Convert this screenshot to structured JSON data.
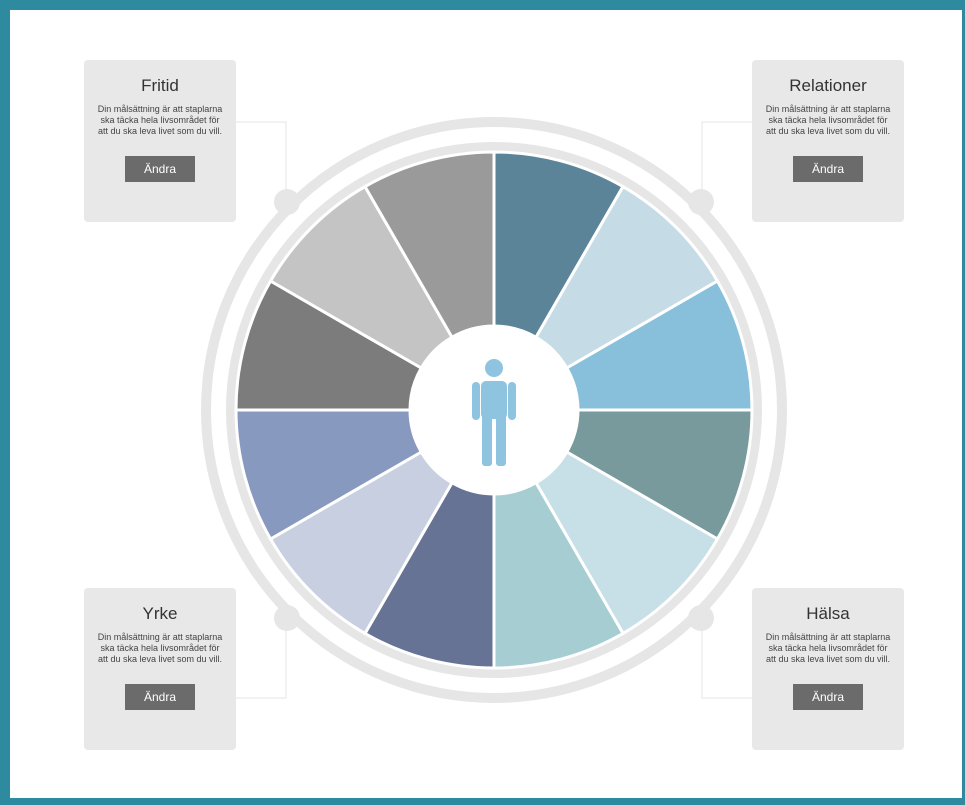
{
  "colors": {
    "frame": "#2e8a9f",
    "ring": "#e6e6e6",
    "card_bg": "#e8e8e8",
    "button_bg": "#6b6b6b",
    "person": "#8ec4df"
  },
  "wheel": {
    "center_icon": "person-icon",
    "segment_colors": [
      "#5b8499",
      "#c5dce6",
      "#88c0dc",
      "#799a9c",
      "#c7dfe6",
      "#a5cdd2",
      "#677394",
      "#c8cfe0",
      "#8899c0",
      "#7c7c7c",
      "#c4c4c4",
      "#9a9a9a"
    ]
  },
  "cards": {
    "fritid": {
      "title": "Fritid",
      "text": "Din målsättning är att staplarna ska täcka hela livsområdet för att du ska leva livet som du vill.",
      "button": "Ändra"
    },
    "relationer": {
      "title": "Relationer",
      "text": "Din målsättning är att staplarna ska täcka hela livsområdet för att du ska leva livet som du vill.",
      "button": "Ändra"
    },
    "yrke": {
      "title": "Yrke",
      "text": "Din målsättning är att staplarna ska täcka hela livsområdet för att du ska leva livet som du vill.",
      "button": "Ändra"
    },
    "halsa": {
      "title": "Hälsa",
      "text": "Din målsättning är att staplarna ska täcka hela livsområdet för att du ska leva livet som du vill.",
      "button": "Ändra"
    }
  }
}
